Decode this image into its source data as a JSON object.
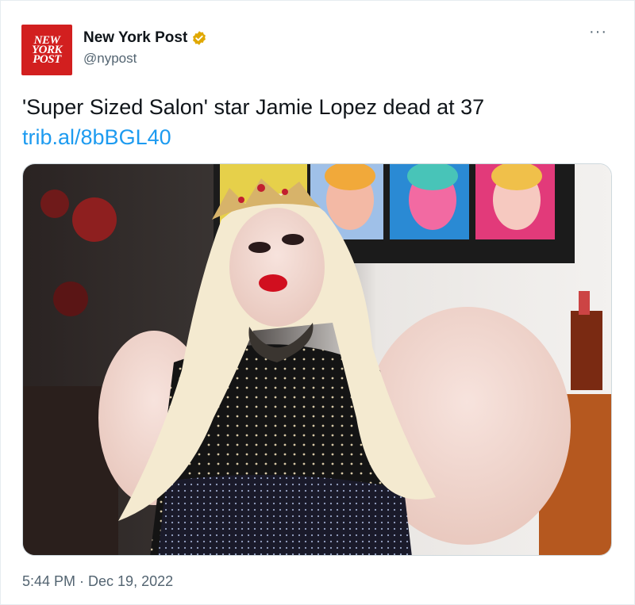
{
  "account": {
    "logo_lines": [
      "NEW",
      "YORK",
      "POST"
    ],
    "display_name": "New York Post",
    "handle": "@nypost",
    "verified_color": "#e0a800"
  },
  "menu": {
    "more_label": "···"
  },
  "tweet": {
    "text": "'Super Sized Salon' star Jamie Lopez dead at 37",
    "link": "trib.al/8bBGL40",
    "timestamp": "5:44 PM · Dec 19, 2022"
  },
  "colors": {
    "brand_red": "#d21f1f",
    "link_blue": "#1d9bf0",
    "secondary_text": "#536471"
  }
}
